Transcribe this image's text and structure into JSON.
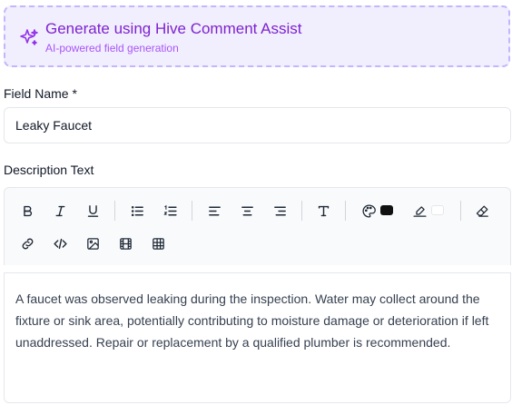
{
  "ai_assist": {
    "title": "Generate using Hive Comment Assist",
    "subtitle": "AI-powered field generation",
    "icon": "sparkles-icon"
  },
  "field_name": {
    "label": "Field Name *",
    "value": "Leaky Faucet"
  },
  "description": {
    "label": "Description Text",
    "text": "A faucet was observed leaking during the inspection. Water may collect around the fixture or sink area, potentially contributing to moisture damage or deterioration if left unaddressed. Repair or replacement by a qualified plumber is recommended."
  },
  "toolbar": {
    "row1": [
      "bold-icon",
      "italic-icon",
      "underline-icon",
      "bullet-list-icon",
      "ordered-list-icon",
      "align-left-icon",
      "align-center-icon",
      "align-right-icon",
      "text-format-icon",
      "text-color-icon",
      "highlight-icon",
      "clear-format-icon"
    ],
    "row2": [
      "link-icon",
      "code-icon",
      "image-icon",
      "video-icon",
      "table-icon"
    ],
    "text_color": "#111111",
    "highlight_color": "#ffffff"
  },
  "colors": {
    "accent": "#7e22ce",
    "banner_bg": "#f1effe",
    "banner_border": "#c4b5fd"
  }
}
